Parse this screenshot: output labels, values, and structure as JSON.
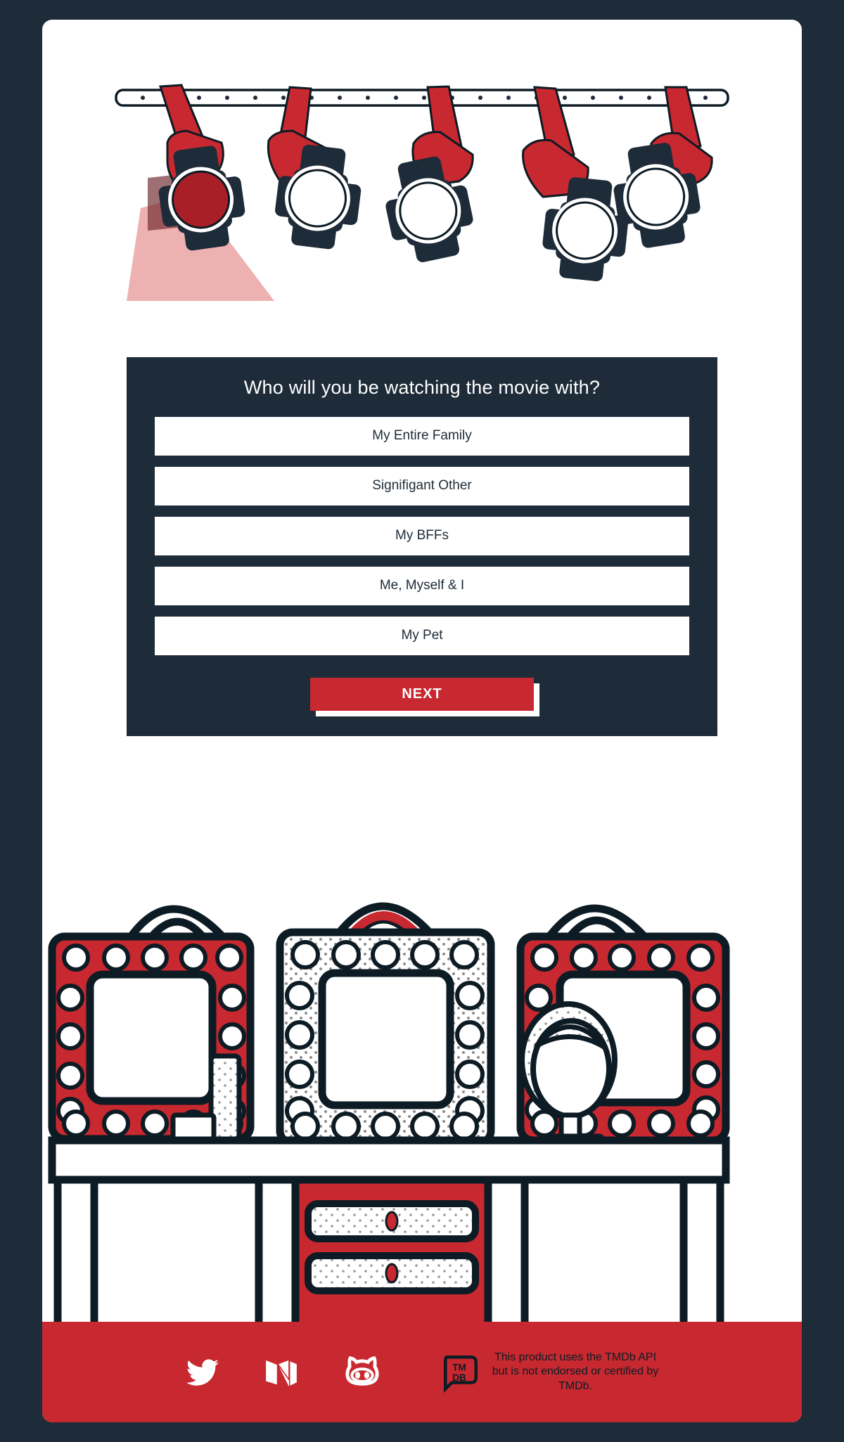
{
  "theme": {
    "background": "#1e2b38",
    "card": "#ffffff",
    "panel": "#1e2b38",
    "accent_red": "#c8282f",
    "dark_navy": "#1e2b38",
    "beam_pink": "#edb1b1",
    "lit_lens_red": "#a81f28"
  },
  "quiz": {
    "title": "Who will you be watching the movie with?",
    "options": [
      {
        "label": "My Entire Family"
      },
      {
        "label": "Signifigant Other"
      },
      {
        "label": "My BFFs"
      },
      {
        "label": "Me, Myself & I"
      },
      {
        "label": "My Pet"
      }
    ],
    "next_label": "NEXT"
  },
  "illustration_top": {
    "name": "stage-lights",
    "description": "Row of five stage spotlights hanging from a truss bar, leftmost one lit",
    "light_count": 5,
    "lit_index": 0
  },
  "illustration_bottom": {
    "name": "vanity-mirrors-desk",
    "description": "Three bulb-framed vanity mirrors on a desk with two drawers and a wig stand",
    "mirror_count": 3,
    "drawer_count": 2
  },
  "footer": {
    "social": [
      {
        "icon": "twitter-icon",
        "name": "Twitter"
      },
      {
        "icon": "medium-icon",
        "name": "Medium"
      },
      {
        "icon": "github-icon",
        "name": "GitHub"
      }
    ],
    "tmdb": {
      "logo_line1": "TM",
      "logo_line2": "DB",
      "notice": "This product uses the TMDb API but is not endorsed or certified by TMDb."
    }
  }
}
